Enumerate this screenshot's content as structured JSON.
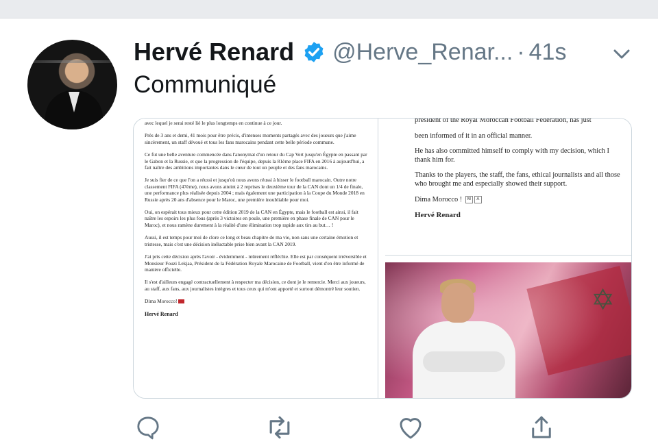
{
  "tweet": {
    "author_name": "Hervé Renard",
    "handle": "@Herve_Renar...",
    "separator": "·",
    "time": "41s",
    "text": "Communiqué"
  },
  "document_left": {
    "paragraphs": [
      "avec lequel je serai resté lié le plus longtemps en continue à ce jour.",
      "Près de 3 ans et demi, 41 mois pour être précis, d'intenses moments partagés avec des joueurs que j'aime sincèrement, un staff dévoué et tous les fans marocains pendant cette belle période commune.",
      "Ce fut une belle aventure commencée dans l'anonymat d'un retour du Cap Vert jusqu'en Égypte en passant par le Gabon et la Russie, et que la progression de l'équipe, depuis la 81ème place FIFA en 2016 à aujourd'hui, a fait naître des ambitions importantes dans le cœur de tout un peuple et des fans marocains.",
      "Je suis fier de ce que l'on a réussi et jusqu'où nous avons réussi à hisser le football marocain. Outre notre classement FIFA (47ème), nous avons atteint à 2 reprises le deuxième tour de la CAN dont un 1/4 de finale, une performance plus réalisée depuis 2004 ; mais également une participation à la Coupe du Monde 2018 en Russie après 20 ans d'absence pour le Maroc, une première inoubliable pour moi.",
      "Oui, on espérait tous mieux pour cette édition 2019 de la CAN en Égypte, mais le football est ainsi, il fait naître les espoirs les plus fous (après 3 victoires en poule, une première en phase finale de CAN pour le Maroc), et nous ramène durement à la réalité d'une élimination trop rapide aux tirs au but… !",
      "Aussi, il est temps pour moi de clore ce long et beau chapitre de ma vie, non sans une certaine émotion et tristesse, mais c'est une décision inéluctable prise bien avant la CAN 2019.",
      "J'ai pris cette décision après l'avoir - évidemment - mûrement réfléchie. Elle est par conséquent irréversible et Monsieur Fouzi Lekjaa, Président de la Fédération Royale Marocaine de Football, vient d'en être informé de manière officielle.",
      "Il s'est d'ailleurs engagé contractuellement à respecter ma décision, ce dont je le remercie. Merci aux joueurs, au staff, aux fans, aux journalistes intègres et tous ceux qui m'ont apporté et surtout démontré leur soutien."
    ],
    "closing": "Dima Morocco!",
    "signature": "Hervé Renard"
  },
  "document_right": {
    "cut_line": "president of the Royal Moroccan Football Federation, has just",
    "paragraphs": [
      "been informed of it in an official manner.",
      "He has also committed himself to comply with my decision, which I thank him for.",
      "Thanks to the players, the staff, the fans, ethical journalists and all those who brought me and especially showed their support."
    ],
    "closing": "Dima Morocco !",
    "badges": [
      "M",
      "A"
    ],
    "signature": "Hervé Renard"
  },
  "actions": {
    "reply": "reply-icon",
    "retweet": "retweet-icon",
    "like": "heart-icon",
    "share": "share-icon"
  },
  "colors": {
    "text": "#14171a",
    "secondary": "#657786",
    "verified": "#1da1f2",
    "border": "#ccd6dd"
  }
}
